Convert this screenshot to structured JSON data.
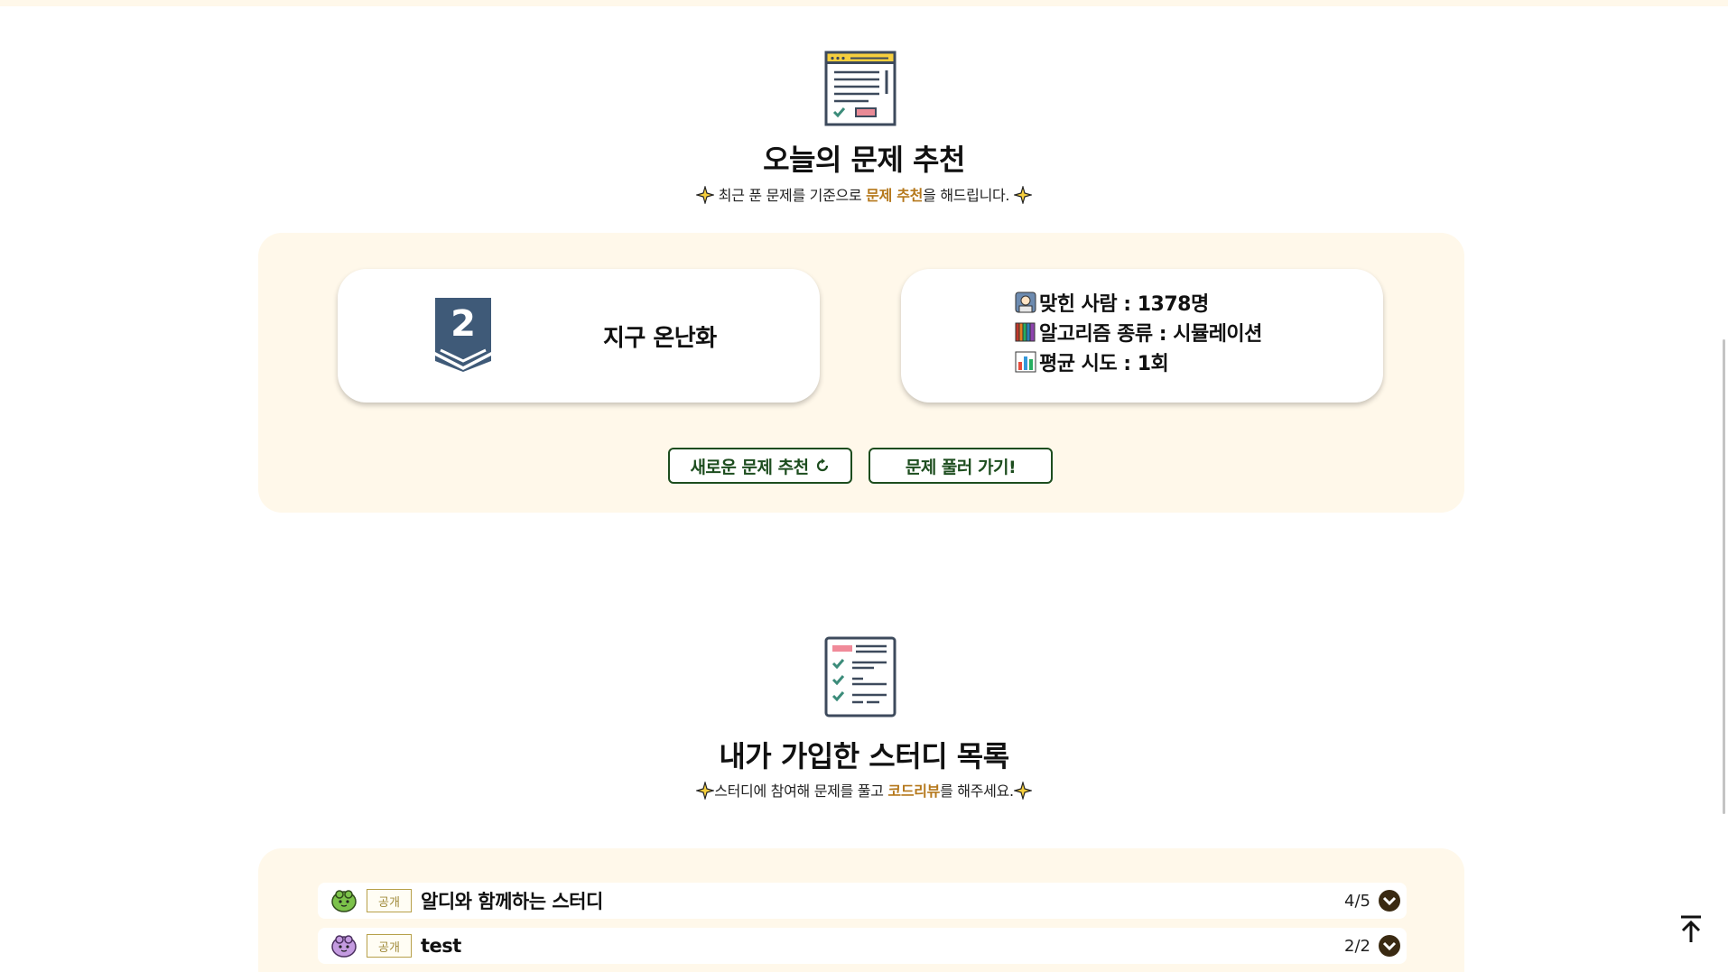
{
  "recommend": {
    "icon": "document-window-icon",
    "title": "오늘의 문제 추천",
    "subtitle_pre": "최근 푼 문제를 기준으로 ",
    "subtitle_accent": "문제 추천",
    "subtitle_post": "을 해드립니다.",
    "problem": {
      "tier_icon": "tier-badge-icon",
      "tier_number": "2",
      "title": "지구 온난화"
    },
    "stats": [
      {
        "icon": "person-icon",
        "text": "맞힌 사람 : 1378명"
      },
      {
        "icon": "books-icon",
        "text": "알고리즘 종류 : 시뮬레이션"
      },
      {
        "icon": "bar-chart-icon",
        "text": "평균 시도 : 1회"
      }
    ],
    "new_button": "새로운 문제 추천",
    "go_button": "문제 풀러 가기!"
  },
  "studies": {
    "icon": "checklist-icon",
    "title": "내가 가입한 스터디 목록",
    "subtitle_pre": "스터디에 참여해 문제를 풀고 ",
    "subtitle_accent": "코드리뷰",
    "subtitle_post": "를 해주세요.",
    "items": [
      {
        "avatar": "green-creature-icon",
        "badge": "공개",
        "name": "알디와 함께하는 스터디",
        "count": "4/5"
      },
      {
        "avatar": "purple-creature-icon",
        "badge": "공개",
        "name": "test",
        "count": "2/2"
      }
    ]
  },
  "colors": {
    "accent": "#b5781c",
    "panel_bg": "#fff8ea",
    "button_border": "#1d4d1e",
    "highlight": "#ffe1a6"
  }
}
